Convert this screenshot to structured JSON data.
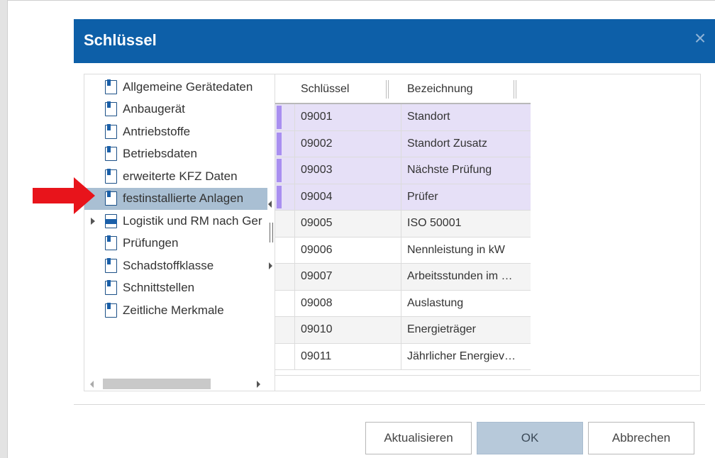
{
  "dialog": {
    "title": "Schlüssel",
    "close_glyph": "×"
  },
  "tree": {
    "items": [
      {
        "label": "Allgemeine Gerätedaten",
        "icon": "document-icon",
        "selected": false,
        "expandable": false
      },
      {
        "label": "Anbaugerät",
        "icon": "document-icon",
        "selected": false,
        "expandable": false
      },
      {
        "label": "Antriebstoffe",
        "icon": "document-icon",
        "selected": false,
        "expandable": false
      },
      {
        "label": "Betriebsdaten",
        "icon": "document-icon",
        "selected": false,
        "expandable": false
      },
      {
        "label": "erweiterte KFZ Daten",
        "icon": "document-icon",
        "selected": false,
        "expandable": false
      },
      {
        "label": "festinstallierte Anlagen",
        "icon": "document-icon",
        "selected": true,
        "expandable": false
      },
      {
        "label": "Logistik und RM nach Ger",
        "icon": "folder-icon",
        "selected": false,
        "expandable": true
      },
      {
        "label": "Prüfungen",
        "icon": "document-icon",
        "selected": false,
        "expandable": false
      },
      {
        "label": "Schadstoffklasse",
        "icon": "document-icon",
        "selected": false,
        "expandable": false
      },
      {
        "label": "Schnittstellen",
        "icon": "document-icon",
        "selected": false,
        "expandable": false
      },
      {
        "label": "Zeitliche Merkmale",
        "icon": "document-icon",
        "selected": false,
        "expandable": false
      }
    ]
  },
  "grid": {
    "columns": [
      "Schlüssel",
      "Bezeichnung"
    ],
    "rows": [
      {
        "key": "09001",
        "name": "Standort",
        "selected": true
      },
      {
        "key": "09002",
        "name": "Standort Zusatz",
        "selected": true
      },
      {
        "key": "09003",
        "name": "Nächste Prüfung",
        "selected": true
      },
      {
        "key": "09004",
        "name": "Prüfer",
        "selected": true
      },
      {
        "key": "09005",
        "name": "ISO 50001",
        "selected": false
      },
      {
        "key": "09006",
        "name": "Nennleistung in kW",
        "selected": false
      },
      {
        "key": "09007",
        "name": "Arbeitsstunden im …",
        "selected": false
      },
      {
        "key": "09008",
        "name": "Auslastung",
        "selected": false
      },
      {
        "key": "09010",
        "name": "Energieträger",
        "selected": false
      },
      {
        "key": "09011",
        "name": "Jährlicher Energiev…",
        "selected": false
      }
    ]
  },
  "buttons": {
    "refresh": "Aktualisieren",
    "ok": "OK",
    "cancel": "Abbrechen"
  },
  "colors": {
    "titlebar": "#0d5fa8",
    "tree_selected": "#a9bfd3",
    "row_selected": "#e6e0f7",
    "row_marker": "#a98ff0",
    "annotation_arrow": "#e8141b"
  }
}
